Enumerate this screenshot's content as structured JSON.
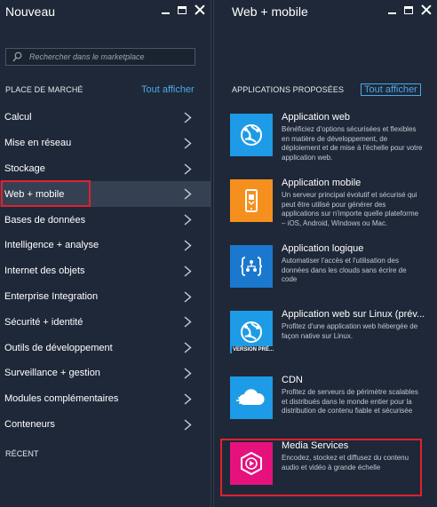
{
  "left_blade": {
    "title": "Nouveau",
    "search_placeholder": "Rechercher dans le marketplace",
    "section_marketplace": "PLACE DE MARCHÉ",
    "show_all": "Tout afficher",
    "section_recent": "RÉCENT",
    "menu_items": [
      {
        "label": "Calcul"
      },
      {
        "label": "Mise en réseau"
      },
      {
        "label": "Stockage"
      },
      {
        "label": "Web + mobile"
      },
      {
        "label": "Bases de données"
      },
      {
        "label": "Intelligence + analyse"
      },
      {
        "label": "Internet des objets"
      },
      {
        "label": "Enterprise Integration"
      },
      {
        "label": "Sécurité + identité"
      },
      {
        "label": "Outils de développement"
      },
      {
        "label": "Surveillance + gestion"
      },
      {
        "label": "Modules complémentaires"
      },
      {
        "label": "Conteneurs"
      }
    ],
    "selected_item": "Web + mobile"
  },
  "right_blade": {
    "title": "Web + mobile",
    "section_label": "APPLICATIONS PROPOSÉES",
    "show_all": "Tout afficher",
    "apps": [
      {
        "name": "Application web",
        "description": "Bénéficiez d'options sécurisées et flexibles en matière de développement, de déploiement et de mise à l'échelle pour votre application web.",
        "icon": "web-app-icon",
        "color": "#1e9be6"
      },
      {
        "name": "Application mobile",
        "description": "Un serveur principal évolutif et sécurisé qui peut être utilisé pour générer des applications sur n'importe quelle plateforme – iOS, Android, Windows ou Mac.",
        "icon": "mobile-app-icon",
        "color": "#f5901f"
      },
      {
        "name": "Application logique",
        "description": "Automatiser l'accès et l'utilisation des données dans les clouds sans écrire de code",
        "icon": "logic-app-icon",
        "color": "#1b78cf"
      },
      {
        "name": "Application web sur Linux (prév...",
        "description": "Profitez d'une application web hébergée de façon native sur Linux.",
        "icon": "web-app-linux-icon",
        "color": "#1e9be6",
        "badge": "VERSION PRÉ..."
      },
      {
        "name": "CDN",
        "description": "Profitez de serveurs de périmètre scalables et distribués dans le monde entier pour la distribution de contenu fiable et sécurisée",
        "icon": "cdn-icon",
        "color": "#1e9be6"
      },
      {
        "name": "Media Services",
        "description": "Encodez, stockez et diffusez du contenu audio et vidéo à grande échelle",
        "icon": "media-services-icon",
        "color": "#e5127d"
      }
    ]
  }
}
